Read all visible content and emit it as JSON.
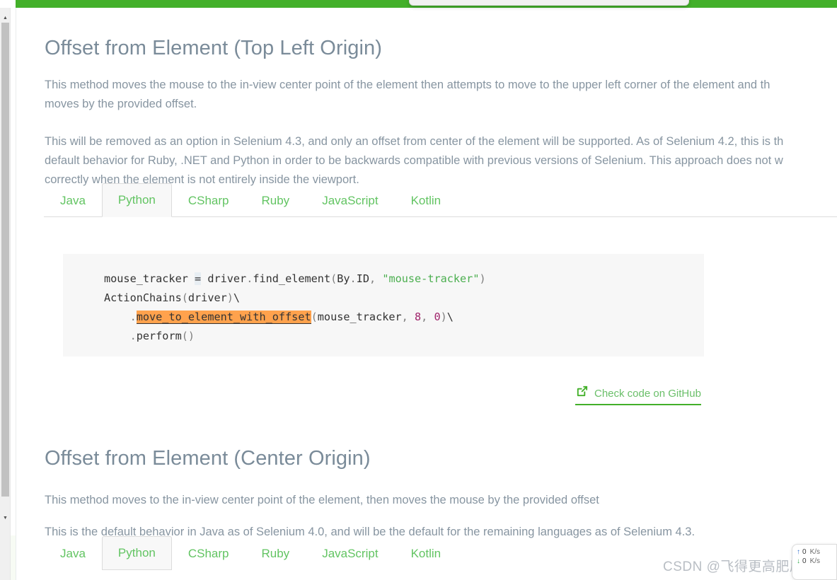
{
  "page": {
    "accent_green": "#43b02a",
    "tab_link_green": "#62c462",
    "heading_color": "#7a8b99",
    "body_color": "#8795a1",
    "code_bg": "#f7f7f7",
    "highlight_orange": "#ffa24d"
  },
  "sections": [
    {
      "title": "Offset from Element (Top Left Origin)",
      "paragraphs": [
        {
          "lines": [
            "This method moves the mouse to the in-view center point of the element then attempts to move to the upper left corner of the element and th",
            "moves by the provided offset."
          ]
        },
        {
          "lines": [
            "This will be removed as an option in Selenium 4.3, and only an offset from center of the element will be supported. As of Selenium 4.2, this is th",
            "default behavior for Ruby, .NET and Python in order to be backwards compatible with previous versions of Selenium. This approach does not w",
            "correctly when the element is not entirely inside the viewport."
          ]
        }
      ]
    },
    {
      "title": "Offset from Element (Center Origin)",
      "paragraphs": [
        {
          "lines": [
            "This method moves to the in-view center point of the element, then moves the mouse by the provided offset"
          ]
        },
        {
          "lines": [
            "This is the default behavior in Java as of Selenium 4.0, and will be the default for the remaining languages as of Selenium 4.3."
          ]
        }
      ]
    }
  ],
  "tabs": {
    "items": [
      "Java",
      "Python",
      "CSharp",
      "Ruby",
      "JavaScript",
      "Kotlin"
    ],
    "active": "Python"
  },
  "code": {
    "language": "Python",
    "tokens": [
      [
        {
          "t": "mouse_tracker",
          "c": "c-name"
        },
        {
          "t": " ",
          "c": "c-plain"
        },
        {
          "t": "=",
          "c": "c-op"
        },
        {
          "t": " driver",
          "c": "c-name"
        },
        {
          "t": ".",
          "c": "c-punc"
        },
        {
          "t": "find_element",
          "c": "c-name"
        },
        {
          "t": "(",
          "c": "c-punc"
        },
        {
          "t": "By",
          "c": "c-name"
        },
        {
          "t": ".",
          "c": "c-punc"
        },
        {
          "t": "ID",
          "c": "c-name"
        },
        {
          "t": ",",
          "c": "c-punc"
        },
        {
          "t": " ",
          "c": "c-plain"
        },
        {
          "t": "\"mouse-tracker\"",
          "c": "c-str"
        },
        {
          "t": ")",
          "c": "c-punc"
        }
      ],
      [
        {
          "t": "ActionChains",
          "c": "c-name"
        },
        {
          "t": "(",
          "c": "c-punc"
        },
        {
          "t": "driver",
          "c": "c-name"
        },
        {
          "t": ")",
          "c": "c-punc"
        },
        {
          "t": "\\",
          "c": "c-name"
        }
      ],
      [
        {
          "t": "    ",
          "c": "c-plain"
        },
        {
          "t": ".",
          "c": "c-punc"
        },
        {
          "t": "move_to_element_with_offset",
          "c": "c-hl"
        },
        {
          "t": "(",
          "c": "c-punc"
        },
        {
          "t": "mouse_tracker",
          "c": "c-name"
        },
        {
          "t": ",",
          "c": "c-punc"
        },
        {
          "t": " ",
          "c": "c-plain"
        },
        {
          "t": "8",
          "c": "c-num"
        },
        {
          "t": ",",
          "c": "c-punc"
        },
        {
          "t": " ",
          "c": "c-plain"
        },
        {
          "t": "0",
          "c": "c-num"
        },
        {
          "t": ")",
          "c": "c-punc"
        },
        {
          "t": "\\",
          "c": "c-name"
        }
      ],
      [
        {
          "t": "    ",
          "c": "c-plain"
        },
        {
          "t": ".",
          "c": "c-punc"
        },
        {
          "t": "perform",
          "c": "c-name"
        },
        {
          "t": "(",
          "c": "c-punc"
        },
        {
          "t": ")",
          "c": "c-punc"
        }
      ]
    ]
  },
  "github_link": {
    "label": "Check code on GitHub",
    "icon": "external-link-icon"
  },
  "watermark": {
    "text": "CSDN @飞得更高肥尾沙鼠"
  },
  "netspeed": {
    "upload": {
      "icon": "arrow-up-icon",
      "value": "0",
      "unit": "K/s"
    },
    "download": {
      "icon": "arrow-down-icon",
      "value": "0",
      "unit": "K/s"
    }
  }
}
